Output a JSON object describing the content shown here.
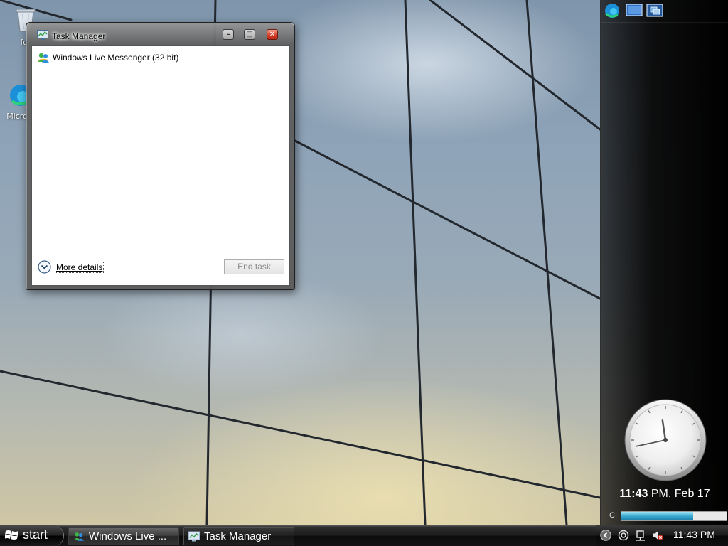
{
  "desktop": {
    "icons": [
      {
        "label": "for",
        "icon": "recycle-bin-icon"
      },
      {
        "label": "Micro",
        "icon": "edge-icon"
      }
    ]
  },
  "task_manager": {
    "title": "Task Manager",
    "apps": [
      {
        "name": "Windows Live Messenger (32 bit)",
        "icon": "messenger-icon"
      }
    ],
    "more_details_label": "More details",
    "end_task_label": "End task",
    "end_task_enabled": false
  },
  "sidebar": {
    "toolbar": [
      "edge-icon",
      "monitor-icon",
      "window-switch-icon"
    ],
    "clock": {
      "hour": 11,
      "minute": 43
    },
    "time_bold": "11:43",
    "time_rest": " PM, Feb 17",
    "drive_label": "C:",
    "drive_used_fraction": 0.68
  },
  "taskbar": {
    "start_label": "start",
    "tasks": [
      {
        "label": "Windows Live ...",
        "icon": "messenger-icon",
        "active": false
      },
      {
        "label": "Task Manager",
        "icon": "task-manager-icon",
        "active": true
      }
    ],
    "tray_icons": [
      "back-arrow-icon",
      "network-icon",
      "safely-remove-icon",
      "speaker-muted-icon"
    ],
    "clock": "11:43 PM"
  },
  "colors": {
    "close_button": "#d6402a",
    "drive_fill": "#3aa9cf"
  }
}
